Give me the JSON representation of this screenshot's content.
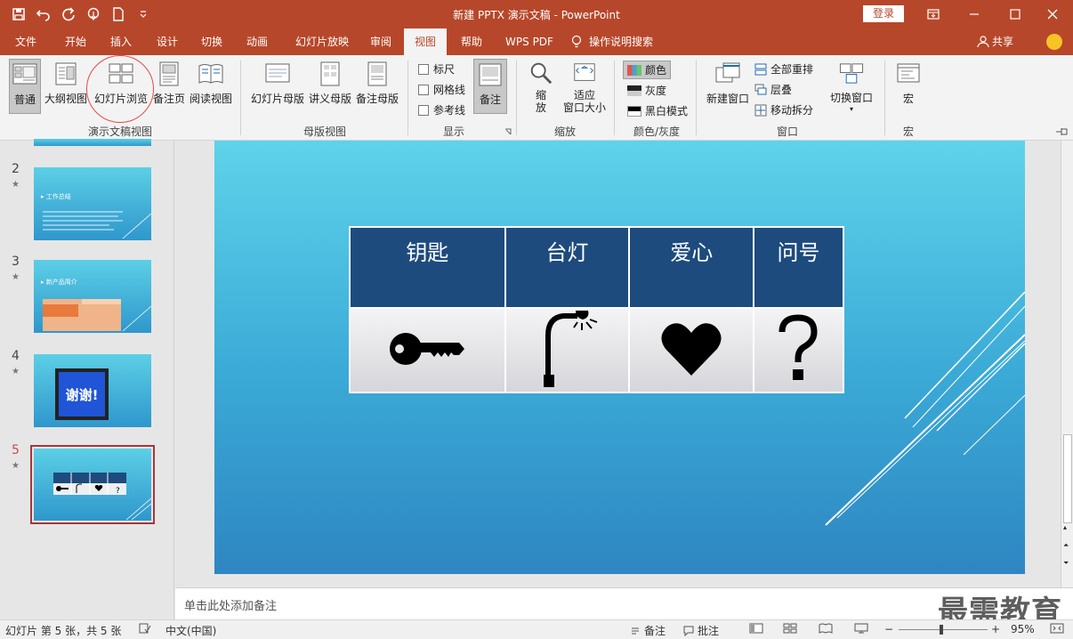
{
  "window": {
    "title": "新建 PPTX 演示文稿 - PowerPoint",
    "login_label": "登录"
  },
  "tabs": [
    {
      "label": "文件"
    },
    {
      "label": "开始"
    },
    {
      "label": "插入"
    },
    {
      "label": "设计"
    },
    {
      "label": "切换"
    },
    {
      "label": "动画"
    },
    {
      "label": "幻灯片放映"
    },
    {
      "label": "审阅"
    },
    {
      "label": "视图"
    },
    {
      "label": "帮助"
    },
    {
      "label": "WPS PDF"
    },
    {
      "label": "操作说明搜索"
    }
  ],
  "share_label": "共享",
  "ribbon": {
    "presentation_views": {
      "group_label": "演示文稿视图",
      "normal": "普通",
      "outline": "大纲视图",
      "slide_sorter": "幻灯片浏览",
      "notes_page": "备注页",
      "reading": "阅读视图"
    },
    "master_views": {
      "group_label": "母版视图",
      "slide_master": "幻灯片母版",
      "handout_master": "讲义母版",
      "notes_master": "备注母版"
    },
    "show": {
      "group_label": "显示",
      "ruler": "标尺",
      "gridlines": "网格线",
      "guides": "参考线",
      "notes": "备注"
    },
    "zoom": {
      "group_label": "缩放",
      "zoom_line1": "缩",
      "zoom_line2": "放",
      "fit_line1": "适应",
      "fit_line2": "窗口大小"
    },
    "color": {
      "group_label": "颜色/灰度",
      "color": "颜色",
      "grayscale": "灰度",
      "bw": "黑白模式"
    },
    "window": {
      "group_label": "窗口",
      "new_window": "新建窗口",
      "arrange_all": "全部重排",
      "cascade": "层叠",
      "move_split": "移动拆分",
      "switch_windows": "切换窗口"
    },
    "macros": {
      "group_label": "宏",
      "macros": "宏"
    }
  },
  "thumbnails": [
    {
      "num": "2",
      "title": "▸ 工作总结"
    },
    {
      "num": "3",
      "title": "▸ 新产品简介"
    },
    {
      "num": "4",
      "text": "谢谢!"
    },
    {
      "num": "5"
    }
  ],
  "slide_table": {
    "headers": [
      "钥匙",
      "台灯",
      "爱心",
      "问号"
    ]
  },
  "notes_placeholder": "单击此处添加备注",
  "watermark": "最需教育",
  "status": {
    "slide_info": "幻灯片 第 5 张，共 5 张",
    "language": "中文(中国)",
    "notes": "备注",
    "comments": "批注",
    "zoom": "95%"
  }
}
